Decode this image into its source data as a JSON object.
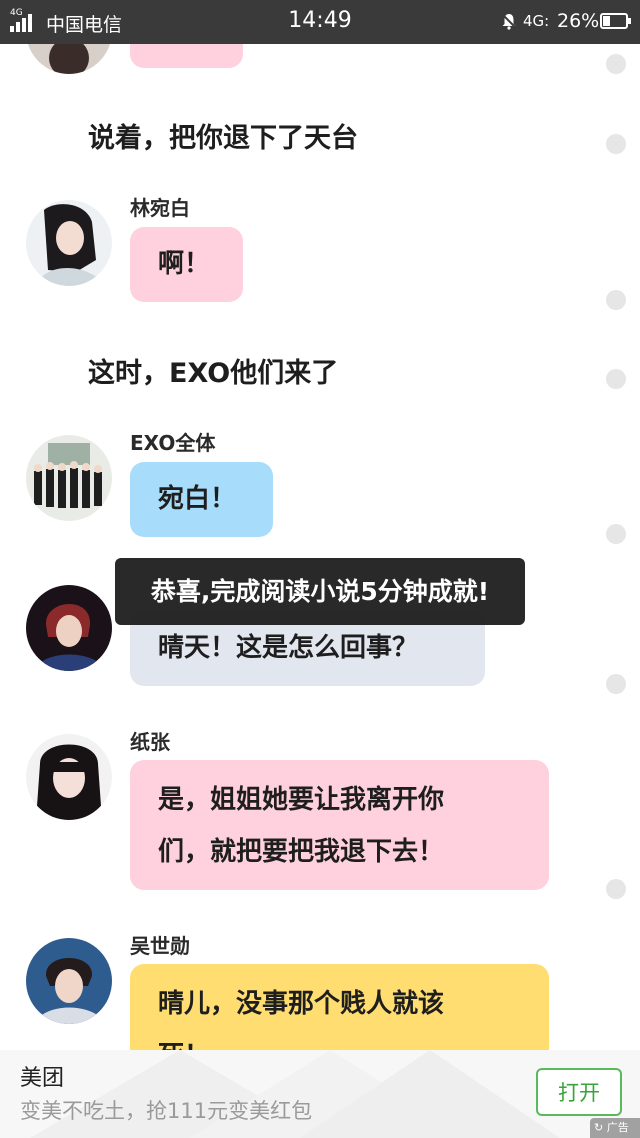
{
  "status_bar": {
    "network_badge": "4G",
    "carrier": "中国电信",
    "time": "14:49",
    "mobile_data": "4G:",
    "battery": "26%"
  },
  "chat": {
    "top_partial_bubble_color": "#ffd0dd",
    "narration_1": "说着，把你退下了天台",
    "message_1": {
      "speaker": "林宛白",
      "text": "啊！",
      "color": "#ffd0dd"
    },
    "narration_2": "这时，EXO他们来了",
    "message_2": {
      "speaker": "EXO全体",
      "text": "宛白！",
      "color": "#a8dcfb"
    },
    "message_3": {
      "text": "晴天！这是怎么回事？",
      "color": "#e2e7ef"
    },
    "message_4": {
      "speaker": "纸张",
      "line_1": "是，姐姐她要让我离开你",
      "line_2": "们，就把要把我退下去！",
      "color": "#ffd0dd"
    },
    "message_5": {
      "speaker": "吴世勋",
      "line_1": "晴儿，没事那个贱人就该",
      "line_2": "死！",
      "color": "#ffdd70"
    }
  },
  "toast": {
    "text": "恭喜,完成阅读小说5分钟成就!"
  },
  "ad": {
    "title": "美团",
    "description": "变美不吃土，抢111元变美红包",
    "open_button": "打开",
    "ad_label": "广告",
    "accent_color": "#5cb85c"
  }
}
